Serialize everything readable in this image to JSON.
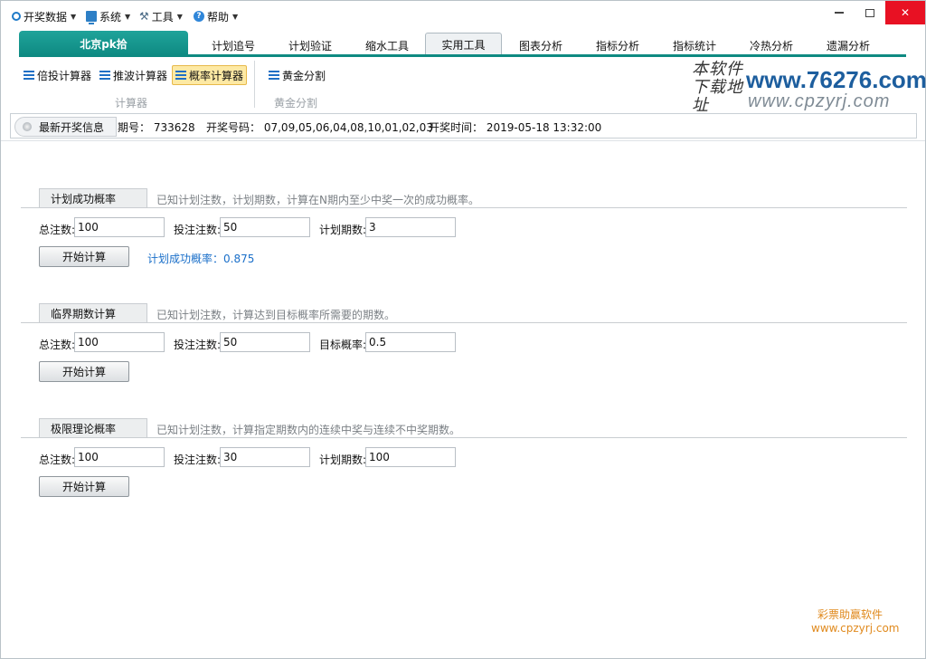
{
  "menu": {
    "items": [
      {
        "label": "开奖数据",
        "icon": "circle-icon"
      },
      {
        "label": "系统",
        "icon": "monitor-icon"
      },
      {
        "label": "工具",
        "icon": "tools-icon"
      },
      {
        "label": "帮助",
        "icon": "help-icon"
      }
    ],
    "arrow": "▼"
  },
  "window_controls": {
    "close": "✕"
  },
  "tabs": {
    "lottery": "北京pk拾",
    "items": [
      "计划追号",
      "计划验证",
      "缩水工具",
      "实用工具",
      "图表分析",
      "指标分析",
      "指标统计",
      "冷热分析",
      "遗漏分析"
    ],
    "active": "实用工具"
  },
  "ribbon": {
    "calc_group": {
      "buttons": [
        "倍投计算器",
        "推波计算器",
        "概率计算器"
      ],
      "active": "概率计算器",
      "label": "计算器"
    },
    "golden_group": {
      "buttons": [
        "黄金分割"
      ],
      "label": "黄金分割"
    }
  },
  "watermark": {
    "hand_text": "本软件下载地址",
    "site": "www.76276.com",
    "site2": "www.cpzyrj.com"
  },
  "info_bar": {
    "tag": "最新开奖信息",
    "period_label": "期号：",
    "period_value": "733628",
    "numbers_label": "开奖号码：",
    "numbers_value": "07,09,05,06,04,08,10,01,02,03",
    "time_label": "开奖时间：",
    "time_value": "2019-05-18 13:32:00"
  },
  "sections": [
    {
      "title": "计划成功概率",
      "desc": "已知计划注数，计划期数，计算在N期内至少中奖一次的成功概率。",
      "fields": [
        {
          "label": "总注数:",
          "value": "100"
        },
        {
          "label": "投注注数:",
          "value": "50"
        },
        {
          "label": "计划期数:",
          "value": "3"
        }
      ],
      "button": "开始计算",
      "result": "计划成功概率：0.875"
    },
    {
      "title": "临界期数计算",
      "desc": "已知计划注数，计算达到目标概率所需要的期数。",
      "fields": [
        {
          "label": "总注数:",
          "value": "100"
        },
        {
          "label": "投注注数:",
          "value": "50"
        },
        {
          "label": "目标概率:",
          "value": "0.5"
        }
      ],
      "button": "开始计算",
      "result": ""
    },
    {
      "title": "极限理论概率",
      "desc": "已知计划注数，计算指定期数内的连续中奖与连续不中奖期数。",
      "fields": [
        {
          "label": "总注数:",
          "value": "100"
        },
        {
          "label": "投注注数:",
          "value": "30"
        },
        {
          "label": "计划期数:",
          "value": "100"
        }
      ],
      "button": "开始计算",
      "result": ""
    }
  ],
  "footer": {
    "brand": "彩票助赢软件",
    "site": "www.cpzyrj.com"
  },
  "colors": {
    "accent_teal": "#0e8a82",
    "result_blue": "#1a6fc9",
    "footer_orange": "#e08a1e",
    "close_red": "#e81123"
  }
}
